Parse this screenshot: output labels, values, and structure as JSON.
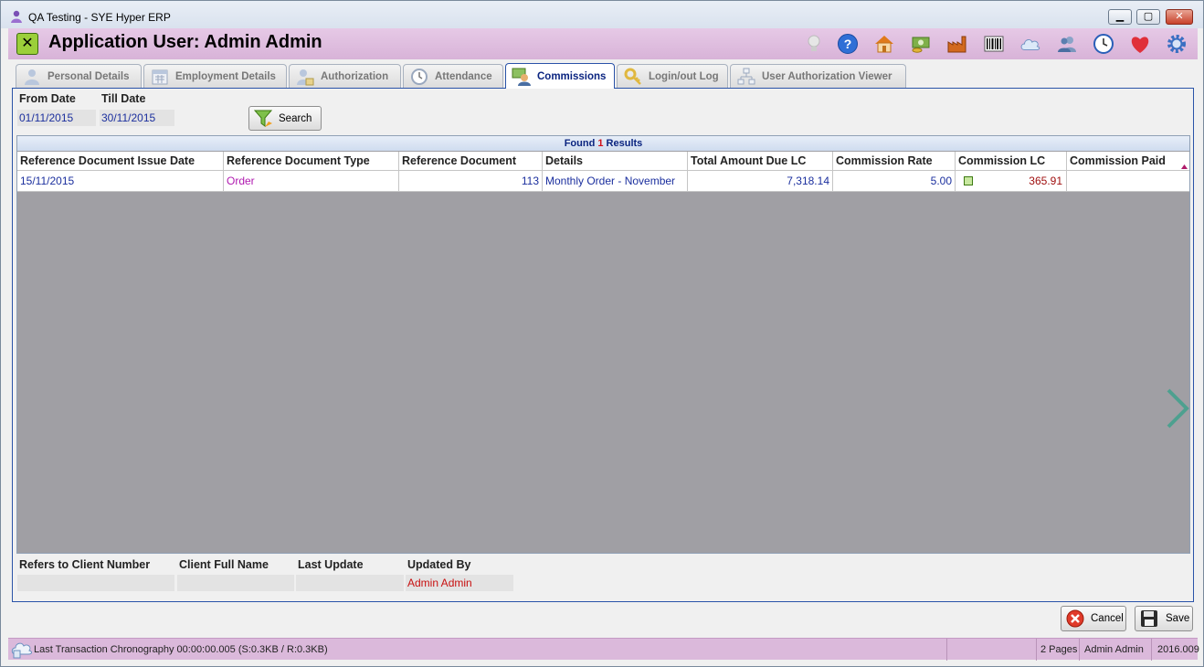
{
  "window": {
    "title": "QA Testing - SYE Hyper ERP",
    "controls": {
      "minimize": "▁",
      "maximize": "▢",
      "close": "✕"
    }
  },
  "header": {
    "title": "Application User: Admin Admin",
    "close_glyph": "✕",
    "toolbar_icons": [
      "lightbulb-icon",
      "help-icon",
      "home-icon",
      "money-icon",
      "factory-icon",
      "barcode-icon",
      "cloud-icon",
      "users-icon",
      "clock-icon",
      "heart-icon",
      "gear-icon"
    ]
  },
  "tabs": [
    {
      "label": "Personal Details",
      "icon": "person-icon"
    },
    {
      "label": "Employment Details",
      "icon": "calendar-icon"
    },
    {
      "label": "Authorization",
      "icon": "lock-user-icon"
    },
    {
      "label": "Attendance",
      "icon": "clock-icon"
    },
    {
      "label": "Commissions",
      "icon": "commission-icon",
      "active": true
    },
    {
      "label": "Login/out Log",
      "icon": "key-icon"
    },
    {
      "label": "User Authorization Viewer",
      "icon": "hierarchy-icon"
    }
  ],
  "filters": {
    "from_date_label": "From Date",
    "from_date_value": "01/11/2015",
    "till_date_label": "Till Date",
    "till_date_value": "30/11/2015",
    "search_label": "Search"
  },
  "results": {
    "found_prefix": "Found",
    "count": "1",
    "found_suffix": "Results"
  },
  "table": {
    "headers": [
      "Reference Document Issue Date",
      "Reference Document Type",
      "Reference Document",
      "Details",
      "Total Amount Due LC",
      "Commission Rate",
      "Commission LC",
      "Commission Paid"
    ],
    "rows": [
      {
        "issue_date": "15/11/2015",
        "doc_type": "Order",
        "doc_number": "113",
        "details": "Monthly Order - November",
        "total_due": "7,318.14",
        "rate": "5.00",
        "commission_lc": "365.91",
        "commission_paid": ""
      }
    ]
  },
  "footer_fields": {
    "client_number_label": "Refers to Client Number",
    "client_number_value": "",
    "client_name_label": "Client Full Name",
    "client_name_value": "",
    "last_update_label": "Last Update",
    "last_update_value": "",
    "updated_by_label": "Updated By",
    "updated_by_value": "Admin Admin"
  },
  "actions": {
    "cancel_label": "Cancel",
    "save_label": "Save"
  },
  "statusbar": {
    "chronography": "Last Transaction Chronography  00:00:00.005   (S:0.3KB / R:0.3KB)",
    "pages": "2 Pages",
    "user": "Admin Admin",
    "version": "2016.009"
  },
  "colors": {
    "header_bg": "#d8b3d8",
    "accent_blue": "#0a2480",
    "value_blue": "#1b2f9e",
    "order_purple": "#b01ab0",
    "commission_red": "#a01010",
    "grid_bg": "#a09fa4"
  }
}
